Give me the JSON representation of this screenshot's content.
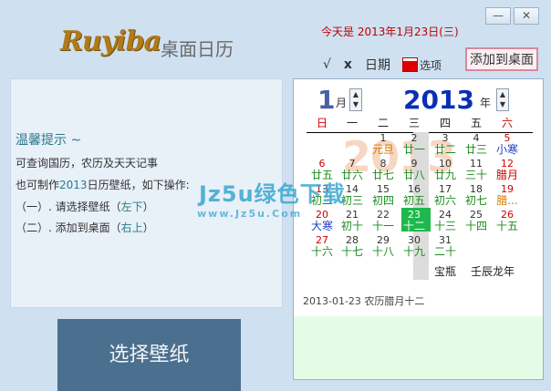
{
  "window": {
    "min_label": "—",
    "close_label": "✕"
  },
  "logo": {
    "brand": "Ruyiba",
    "subtitle": "桌面日历"
  },
  "today_text": "今天是 2013年1月23日(三)",
  "toolbar": {
    "ok_label": "√",
    "x_label": "x",
    "date_label": "日期",
    "options_label": "选项",
    "add_desktop_label": "添加到桌面"
  },
  "tips": {
    "title": "温馨提示 ~",
    "line1": "可查询国历，农历及天天记事",
    "line2a": "也可制作",
    "line2b": "2013",
    "line2c": "日历壁纸，如下操作:",
    "line3a": "（一）. 请选择壁纸（",
    "line3b": "左下",
    "line3c": "）",
    "line4a": "（二）. 添加到桌面（",
    "line4b": "右上",
    "line4c": "）"
  },
  "choose_wallpaper_label": "选择壁纸",
  "calendar": {
    "month": "1",
    "month_unit": "月",
    "year": "2013",
    "year_unit": "年",
    "bg_year": "2013",
    "weekdays": [
      "日",
      "一",
      "二",
      "三",
      "四",
      "五",
      "六"
    ],
    "weeks": [
      [
        null,
        null,
        {
          "n": "1",
          "l": "元旦",
          "nc": "",
          "lc": "orange"
        },
        {
          "n": "2",
          "l": "廿一",
          "nc": "",
          "lc": ""
        },
        {
          "n": "3",
          "l": "廿二",
          "nc": "",
          "lc": ""
        },
        {
          "n": "4",
          "l": "廿三",
          "nc": "",
          "lc": ""
        },
        {
          "n": "5",
          "l": "小寒",
          "nc": "red",
          "lc": "blue"
        }
      ],
      [
        {
          "n": "6",
          "l": "廿五",
          "nc": "red",
          "lc": ""
        },
        {
          "n": "7",
          "l": "廿六",
          "nc": "",
          "lc": ""
        },
        {
          "n": "8",
          "l": "廿七",
          "nc": "",
          "lc": ""
        },
        {
          "n": "9",
          "l": "廿八",
          "nc": "",
          "lc": ""
        },
        {
          "n": "10",
          "l": "廿九",
          "nc": "",
          "lc": ""
        },
        {
          "n": "11",
          "l": "三十",
          "nc": "",
          "lc": ""
        },
        {
          "n": "12",
          "l": "腊月",
          "nc": "red",
          "lc": "red"
        }
      ],
      [
        {
          "n": "13",
          "l": "初二",
          "nc": "red",
          "lc": ""
        },
        {
          "n": "14",
          "l": "初三",
          "nc": "",
          "lc": ""
        },
        {
          "n": "15",
          "l": "初四",
          "nc": "",
          "lc": ""
        },
        {
          "n": "16",
          "l": "初五",
          "nc": "",
          "lc": ""
        },
        {
          "n": "17",
          "l": "初六",
          "nc": "",
          "lc": ""
        },
        {
          "n": "18",
          "l": "初七",
          "nc": "",
          "lc": ""
        },
        {
          "n": "19",
          "l": "腊...",
          "nc": "red",
          "lc": "orange"
        }
      ],
      [
        {
          "n": "20",
          "l": "大寒",
          "nc": "red",
          "lc": "blue"
        },
        {
          "n": "21",
          "l": "初十",
          "nc": "",
          "lc": ""
        },
        {
          "n": "22",
          "l": "十一",
          "nc": "",
          "lc": ""
        },
        {
          "n": "23",
          "l": "十二",
          "nc": "white",
          "lc": "white"
        },
        {
          "n": "24",
          "l": "十三",
          "nc": "",
          "lc": ""
        },
        {
          "n": "25",
          "l": "十四",
          "nc": "",
          "lc": ""
        },
        {
          "n": "26",
          "l": "十五",
          "nc": "red",
          "lc": ""
        }
      ],
      [
        {
          "n": "27",
          "l": "十六",
          "nc": "red",
          "lc": ""
        },
        {
          "n": "28",
          "l": "十七",
          "nc": "",
          "lc": ""
        },
        {
          "n": "29",
          "l": "十八",
          "nc": "",
          "lc": ""
        },
        {
          "n": "30",
          "l": "十九",
          "nc": "",
          "lc": ""
        },
        {
          "n": "31",
          "l": "二十",
          "nc": "",
          "lc": ""
        },
        null,
        null
      ]
    ],
    "extra_zodiac": "宝瓶",
    "extra_ganzhi": "壬辰龙年",
    "info": "2013-01-23  农历腊月十二"
  },
  "watermark": {
    "main": "Jz5u绿色下载",
    "url": "www.Jz5u.Com"
  }
}
